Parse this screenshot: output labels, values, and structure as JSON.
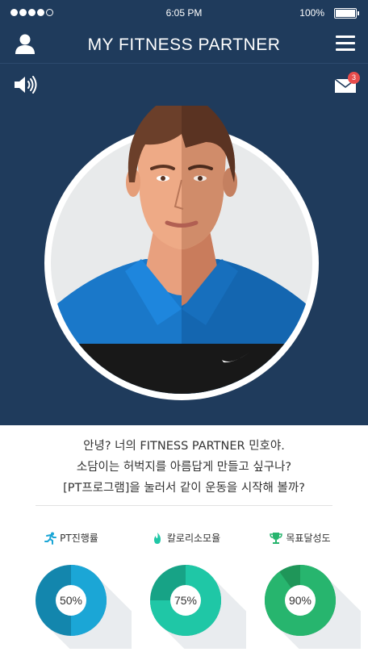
{
  "status_bar": {
    "time": "6:05 PM",
    "battery": "100%",
    "signal_dots": [
      true,
      true,
      true,
      true,
      false
    ]
  },
  "header": {
    "title": "MY FITNESS PARTNER",
    "left_icon": "user-icon",
    "right_icon": "menu-icon"
  },
  "toolbar": {
    "sound_icon": "speaker-icon",
    "mail_icon": "mail-icon",
    "mail_badge": "3"
  },
  "message": {
    "lines": [
      "안녕? 너의 FITNESS PARTNER 민호야.",
      "소담이는 허벅지를 아름답게 만들고 싶구나?",
      "[PT프로그램]을 눌러서 같이 운동을 시작해 볼까?"
    ]
  },
  "stats": [
    {
      "label": "PT진행률",
      "icon": "running-icon",
      "percent": 50,
      "value_text": "50%",
      "color": "#1ba6d6",
      "color_dark": "#1386ad"
    },
    {
      "label": "칼로리소모율",
      "icon": "flame-icon",
      "percent": 75,
      "value_text": "75%",
      "color": "#1fc7a6",
      "color_dark": "#17a386"
    },
    {
      "label": "목표달성도",
      "icon": "trophy-icon",
      "percent": 90,
      "value_text": "90%",
      "color": "#27b56e",
      "color_dark": "#1f9659"
    }
  ],
  "colors": {
    "header_bg": "#1f3b5c",
    "badge": "#e74c4c"
  }
}
